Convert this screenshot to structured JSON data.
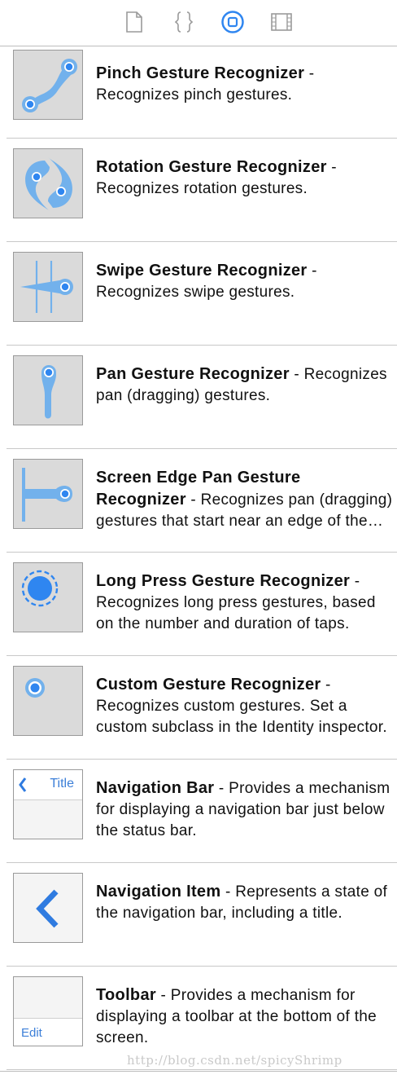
{
  "tabs": [
    {
      "name": "file-inspector"
    },
    {
      "name": "quick-help"
    },
    {
      "name": "object-library",
      "active": true
    },
    {
      "name": "media-library"
    }
  ],
  "items": [
    {
      "title": "Pinch Gesture Recognizer",
      "desc": " - Recognizes pinch gestures.",
      "icon": "pinch-gesture-icon"
    },
    {
      "title": "Rotation Gesture Recognizer",
      "desc": " - Recognizes rotation gestures.",
      "icon": "rotation-gesture-icon"
    },
    {
      "title": "Swipe Gesture Recognizer",
      "desc": " - Recognizes swipe gestures.",
      "icon": "swipe-gesture-icon"
    },
    {
      "title": "Pan Gesture Recognizer",
      "desc": " - Recognizes pan (dragging) gestures.",
      "icon": "pan-gesture-icon"
    },
    {
      "title": "Screen Edge Pan Gesture Recognizer",
      "desc": " - Recognizes pan (dragging) gestures that start near an edge of the screen.",
      "icon": "screen-edge-pan-icon"
    },
    {
      "title": "Long Press Gesture Recognizer",
      "desc": " - Recognizes long press gestures, based on the number and duration of taps.",
      "icon": "long-press-gesture-icon"
    },
    {
      "title": "Custom Gesture Recognizer",
      "desc": " - Recognizes custom gestures. Set a custom subclass in the Identity inspector.",
      "icon": "custom-gesture-icon"
    },
    {
      "title": "Navigation Bar",
      "desc": " - Provides a mechanism for displaying a navigation bar just below the status bar.",
      "icon": "navigation-bar-icon",
      "thumb_label": "Title"
    },
    {
      "title": "Navigation Item",
      "desc": " - Represents a state of the navigation bar, including a title.",
      "icon": "navigation-item-icon"
    },
    {
      "title": "Toolbar",
      "desc": " - Provides a mechanism for displaying a toolbar at the bottom of the screen.",
      "icon": "toolbar-icon",
      "thumb_label": "Edit"
    }
  ],
  "watermark": "http://blog.csdn.net/spicyShrimp",
  "colors": {
    "accent": "#2f86f0",
    "icon_fill": "#72b1ec",
    "thumb_bg": "#dadada"
  }
}
